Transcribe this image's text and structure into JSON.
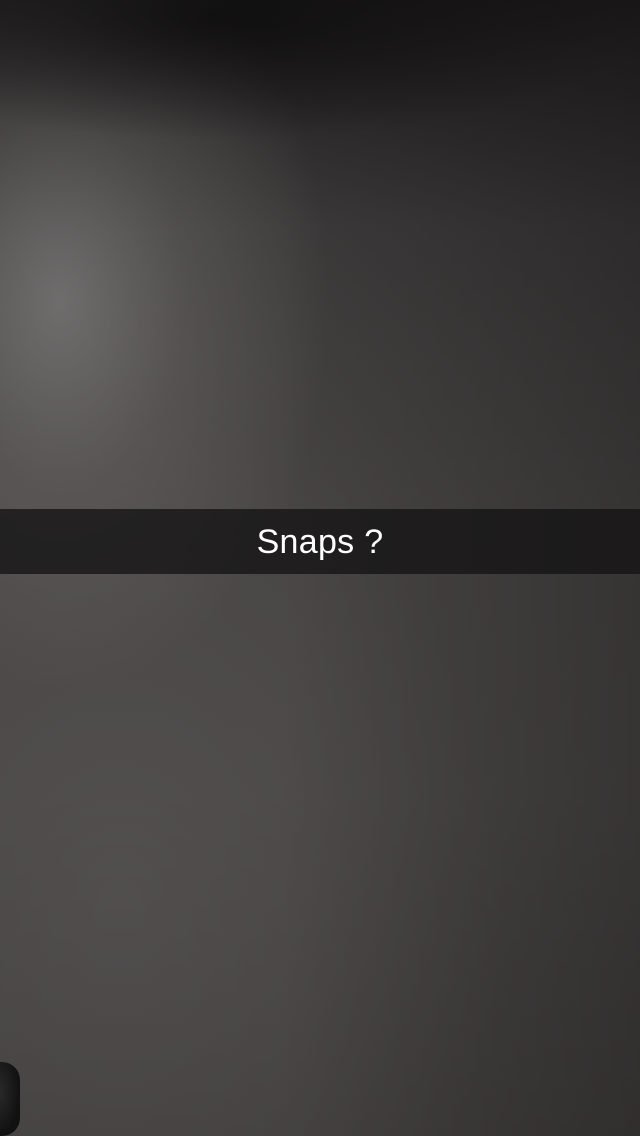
{
  "snap": {
    "caption": "Snaps ?"
  },
  "colors": {
    "caption_bar": "#141313",
    "caption_text": "#ffffff",
    "background_dark": "#1b1919",
    "background_mid": "#484545"
  }
}
